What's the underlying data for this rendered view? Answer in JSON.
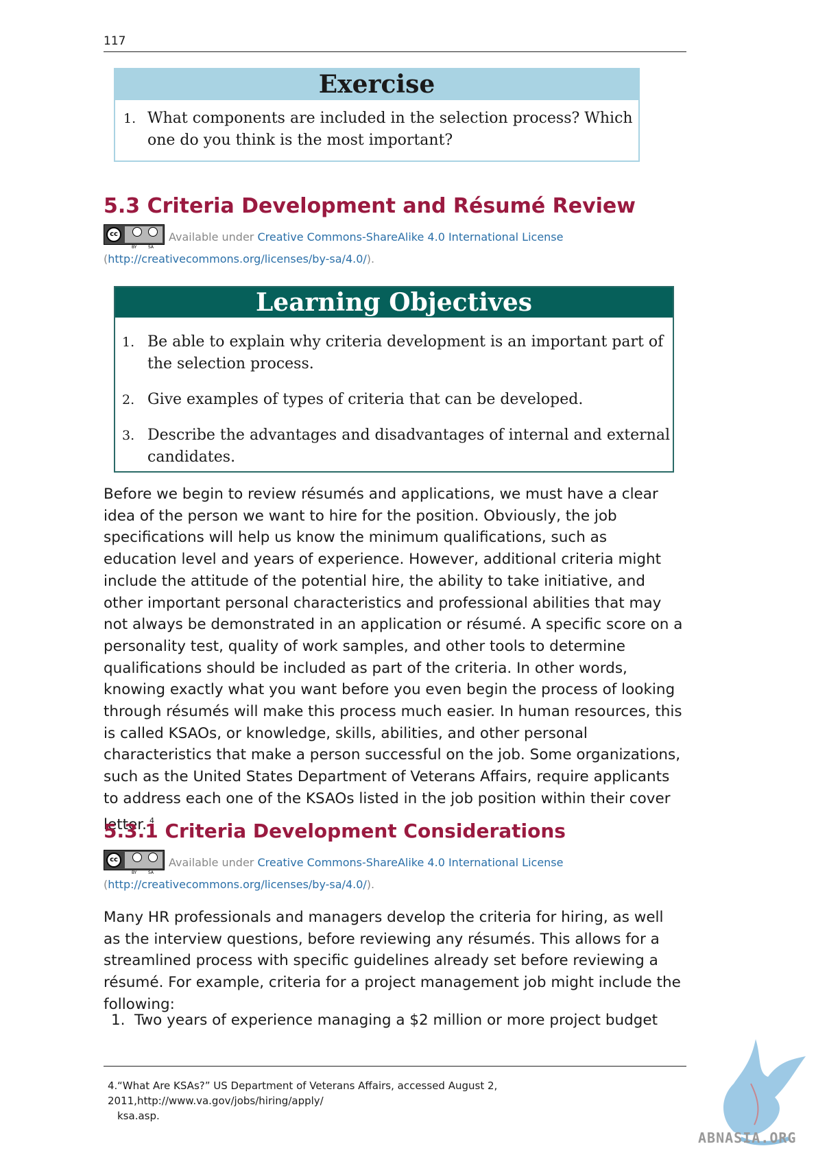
{
  "page_number": "117",
  "exercise": {
    "title": "Exercise",
    "items": [
      {
        "num": "1.",
        "text": "What components are included in the selection process? Which one do you think is the most important?"
      }
    ]
  },
  "section_5_3": {
    "heading": "5.3 Criteria Development and Résumé Review",
    "license": {
      "prefix": "Available under ",
      "link_text": "Creative Commons-ShareAlike 4.0 International License",
      "paren_open": " (",
      "url": "http://creativecommons.org/licenses/by-sa/4.0/",
      "paren_close": ")."
    }
  },
  "learning_objectives": {
    "title": "Learning Objectives",
    "items": [
      {
        "num": "1.",
        "text": "Be able to explain why criteria development is an important part of the selection process."
      },
      {
        "num": "2.",
        "text": "Give examples of types of criteria that can be developed."
      },
      {
        "num": "3.",
        "text": "Describe the advantages and disadvantages of internal and external candidates."
      }
    ]
  },
  "paragraph_1": "Before we begin to review résumés and applications, we must have a clear idea of the person we want to hire for the position. Obviously, the job specifications will help us know the minimum qualifications, such as education level and years of experience. However, additional criteria might include the attitude of the potential hire, the ability to take initiative, and other important personal characteristics and professional abilities that may not always be demonstrated in an application or résumé. A specific score on a personality test, quality of work samples, and other tools to determine qualifications should be included as part of the criteria. In other words, knowing exactly what you want before you even begin the process of looking through résumés will make this process much easier. In human resources, this is called KSAOs, or knowledge, skills, abilities, and other personal characteristics that make a person successful on the job. Some organizations, such as the United States Department of Veterans Affairs, require applicants to address each one of the KSAOs listed in the job position within their cover letter.",
  "paragraph_1_footnote_ref": "4",
  "section_5_3_1": {
    "heading": "5.3.1 Criteria Development Considerations",
    "license": {
      "prefix": "Available under ",
      "link_text": "Creative Commons-ShareAlike 4.0 International License",
      "paren_open": " (",
      "url": "http://creativecommons.org/licenses/by-sa/4.0/",
      "paren_close": ")."
    }
  },
  "paragraph_2": "Many HR professionals and managers develop the criteria for hiring, as well as the interview questions, before reviewing any résumés. This allows for a streamlined process with specific guidelines already set before reviewing a résumé. For example, criteria for a project management job might include the following:",
  "criteria_list": [
    {
      "num": "1.",
      "text": "Two years of experience managing a $2 million or more project budget"
    }
  ],
  "footnote": {
    "num": "4.",
    "line1": "“What Are KSAs?” US Department of Veterans Affairs, accessed August 2, 2011,http://www.va.gov/jobs/hiring/apply/",
    "line2": "ksa.asp."
  },
  "badge": {
    "cc": "cc",
    "by": "BY",
    "sa": "SA"
  },
  "watermark": {
    "text": "ABNASIA.ORG",
    "color": "#7fb6d8"
  }
}
